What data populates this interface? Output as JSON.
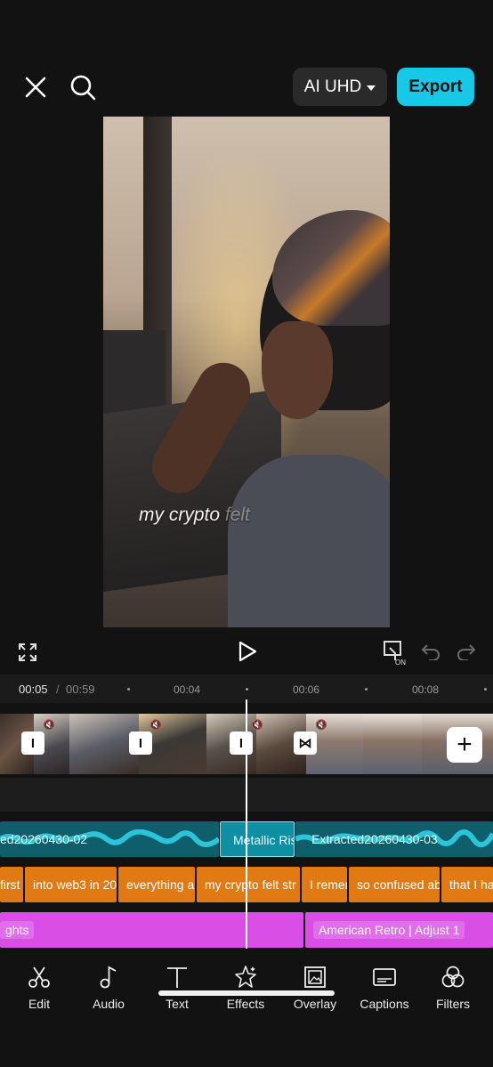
{
  "topbar": {
    "quality_label": "AI UHD",
    "export_label": "Export"
  },
  "preview": {
    "overlay_text_main": "my crypto ",
    "overlay_text_fade": "felt"
  },
  "ruler": {
    "current": "00:05",
    "separator": "/",
    "total": "00:59",
    "ticks": [
      "00:04",
      "00:06",
      "00:08"
    ]
  },
  "tracks": {
    "audio": [
      {
        "label": "ed20260430-02"
      },
      {
        "label": "Metallic Ris"
      },
      {
        "label": "Extracted20260430-03"
      }
    ],
    "captions": [
      "first",
      "into web3 in 20",
      "everything a",
      "my crypto felt str",
      "I remem",
      "so confused ab",
      "that I ha"
    ],
    "filters": [
      "ghts",
      "American Retro | Adjust 1"
    ]
  },
  "toolbar": {
    "items": [
      {
        "label": "Edit",
        "icon": "scissors-icon"
      },
      {
        "label": "Audio",
        "icon": "music-note-icon"
      },
      {
        "label": "Text",
        "icon": "text-icon"
      },
      {
        "label": "Effects",
        "icon": "sparkle-star-icon"
      },
      {
        "label": "Overlay",
        "icon": "overlay-image-icon"
      },
      {
        "label": "Captions",
        "icon": "captions-icon"
      },
      {
        "label": "Filters",
        "icon": "filters-icon"
      }
    ]
  },
  "colors": {
    "accent": "#17c9e6",
    "audio": "#0e5e6b",
    "captions": "#e17a13",
    "filters": "#d94fe6"
  }
}
